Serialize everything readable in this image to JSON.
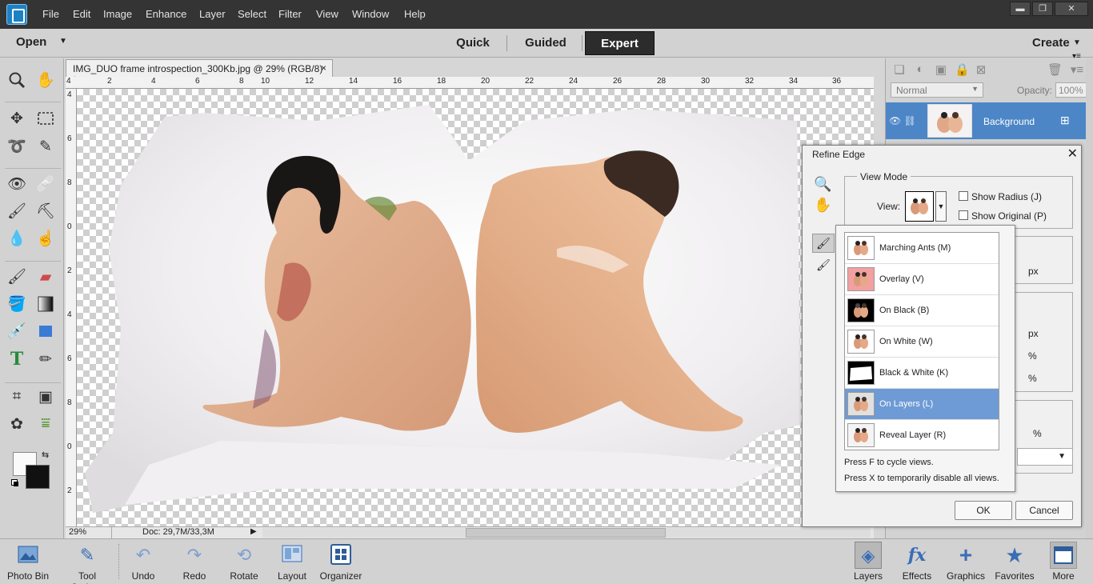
{
  "menubar": {
    "items": [
      "File",
      "Edit",
      "Image",
      "Enhance",
      "Layer",
      "Select",
      "Filter",
      "View",
      "Window",
      "Help"
    ],
    "minimize": "▬",
    "restore": "❐",
    "close": "✕"
  },
  "modebar": {
    "open_label": "Open",
    "tabs": [
      "Quick",
      "Guided",
      "Expert"
    ],
    "active_tab": "Expert",
    "create_label": "Create"
  },
  "document": {
    "tab_title": "IMG_DUO frame introspection_300Kb.jpg @ 29% (RGB/8) *",
    "tab_close": "×",
    "ruler_top": [
      "4",
      "2",
      "4",
      "6",
      "8",
      "10",
      "12",
      "14",
      "16",
      "18",
      "20",
      "22",
      "24",
      "26",
      "28",
      "30",
      "32",
      "34",
      "36"
    ],
    "ruler_left": [
      "4",
      "6",
      "8",
      "0",
      "2",
      "4",
      "6",
      "8",
      "0",
      "2"
    ],
    "zoom": "29%",
    "doc_size": "Doc: 29,7M/33,3M"
  },
  "layers_panel": {
    "blend_mode": "Normal",
    "opacity_label": "Opacity:",
    "opacity_value": "100%",
    "layer_name": "Background"
  },
  "refine_edge": {
    "title": "Refine Edge",
    "view_mode_legend": "View Mode",
    "view_label": "View:",
    "show_radius": "Show Radius (J)",
    "show_original": "Show Original (P)",
    "unit_px_1": "px",
    "unit_px_2": "px",
    "unit_pct_1": "%",
    "unit_pct_2": "%",
    "unit_pct_3": "%",
    "ok_label": "OK",
    "cancel_label": "Cancel",
    "view_options": [
      {
        "label": "Marching Ants (M)",
        "bg": "#ffffff"
      },
      {
        "label": "Overlay (V)",
        "bg": "#f2a0a0"
      },
      {
        "label": "On Black (B)",
        "bg": "#000000"
      },
      {
        "label": "On White (W)",
        "bg": "#ffffff"
      },
      {
        "label": "Black & White (K)",
        "bg": "#000000"
      },
      {
        "label": "On Layers (L)",
        "bg": "#e0e0e0"
      },
      {
        "label": "Reveal Layer (R)",
        "bg": "#f4f4f4"
      }
    ],
    "selected_view": "On Layers (L)",
    "hint_1": "Press F to cycle views.",
    "hint_2": "Press X to temporarily disable all views."
  },
  "bottombar": {
    "left": [
      "Photo Bin",
      "Tool Options",
      "Undo",
      "Redo",
      "Rotate",
      "Layout",
      "Organizer"
    ],
    "right": [
      "Layers",
      "Effects",
      "Graphics",
      "Favorites",
      "More"
    ]
  },
  "colors": {
    "accent": "#4d86c6",
    "selected_row": "#6e9bd6",
    "menubar": "#343434"
  }
}
